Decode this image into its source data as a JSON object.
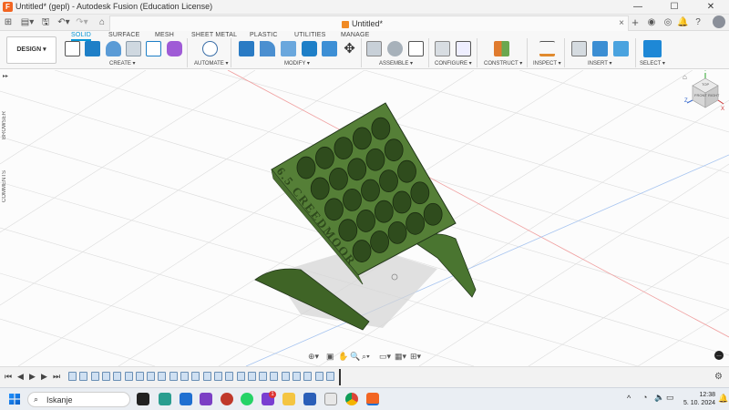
{
  "window": {
    "title": "Untitled* (gepl) - Autodesk Fusion (Education License)",
    "controls": {
      "minimize": "—",
      "maximize": "☐",
      "close": "✕"
    }
  },
  "appbar": {
    "document_tab": "Untitled*",
    "close_tab": "×",
    "icons": [
      "grid-icon",
      "file-menu-icon",
      "save-icon",
      "undo-icon",
      "redo-icon",
      "home-icon",
      "add-tab-icon",
      "extensions-icon",
      "job-status-icon",
      "notifications-icon",
      "help-icon",
      "account-icon"
    ]
  },
  "ribbon": {
    "workspace": "DESIGN ▾",
    "tabs": [
      "SOLID",
      "SURFACE",
      "MESH",
      "SHEET METAL",
      "PLASTIC",
      "UTILITIES",
      "MANAGE"
    ],
    "active_tab": "SOLID",
    "groups": [
      "CREATE ▾",
      "AUTOMATE ▾",
      "MODIFY ▾",
      "ASSEMBLE ▾",
      "CONFIGURE ▾",
      "CONSTRUCT ▾",
      "INSPECT ▾",
      "INSERT ▾",
      "SELECT ▾"
    ],
    "accent": "#0696d7"
  },
  "sidebar": {
    "browser": "BROWSER",
    "comments": "COMMENTS",
    "collapse": "▸▸"
  },
  "viewcube": {
    "top": "TOP",
    "front": "FRONT",
    "right": "RIGHT",
    "axes": {
      "x": "X",
      "y": "Y",
      "z": "Z"
    }
  },
  "model": {
    "engraving": "6.5 CREEDMOOR",
    "color": "#4f7a31"
  },
  "timeline": {
    "controls": [
      "⏮",
      "◀",
      "▶",
      "▶",
      "⏭"
    ]
  },
  "taskbar": {
    "search_placeholder": "Iskanje",
    "badge": "1",
    "clock_time": "12:38",
    "clock_date": "5. 10. 2024"
  }
}
